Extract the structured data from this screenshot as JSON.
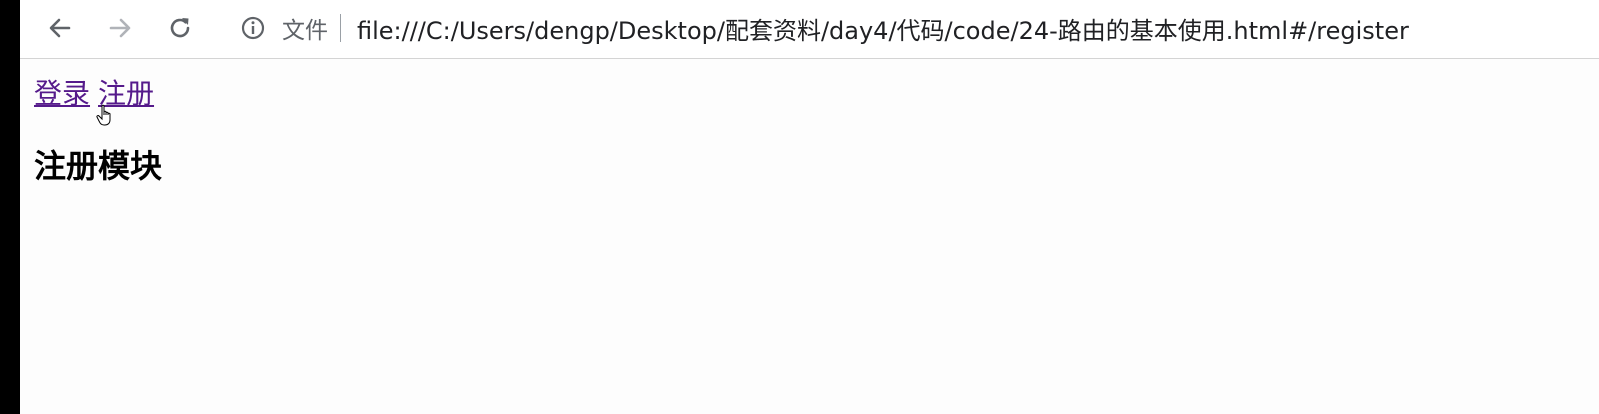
{
  "browser": {
    "security_label": "文件",
    "url": "file:///C:/Users/dengp/Desktop/配套资料/day4/代码/code/24-路由的基本使用.html#/register",
    "icons": {
      "back": "back-arrow-icon",
      "forward": "forward-arrow-icon",
      "reload": "reload-icon",
      "info": "info-icon"
    }
  },
  "page": {
    "links": [
      {
        "label": "登录"
      },
      {
        "label": "注册"
      }
    ],
    "heading": "注册模块",
    "link_color": "#551a8b"
  }
}
